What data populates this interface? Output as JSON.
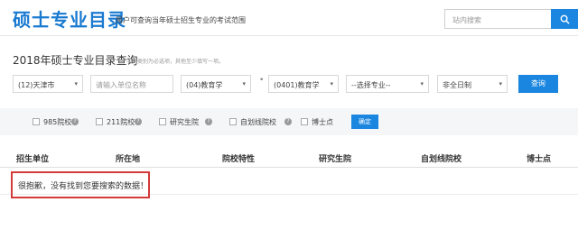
{
  "header": {
    "logo": "硕士专业目录",
    "tagline": "用户可查询当年硕士招生专业的考试范围",
    "search_placeholder": "站内搜索"
  },
  "query": {
    "title": "2018年硕士专业目录查询",
    "hint": "学科类别为必选项，其他至少填写一项。",
    "province": "(12)天津市",
    "unit_placeholder": "请输入单位名称",
    "discipline": "(04)教育学",
    "subject": "(0401)教育学",
    "major": "--选择专业--",
    "study_mode": "非全日制",
    "query_button": "查询"
  },
  "filters": [
    {
      "label": "985院校",
      "help": true
    },
    {
      "label": "211院校",
      "help": true
    },
    {
      "label": "研究生院",
      "help": true
    },
    {
      "label": "自划线院校",
      "help": true
    },
    {
      "label": "博士点",
      "help": false
    }
  ],
  "confirm_button": "确定",
  "table": {
    "headers": [
      "招生单位",
      "所在地",
      "院校特性",
      "研究生院",
      "自划线院校",
      "博士点"
    ],
    "empty_message": "很抱歉，没有找到您要搜索的数据！"
  },
  "colors": {
    "accent": "#1a86e0",
    "highlight": "#d33a3a"
  }
}
